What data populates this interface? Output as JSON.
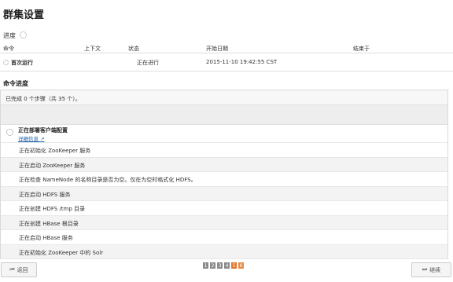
{
  "page": {
    "title": "群集设置",
    "progress_label": "进度"
  },
  "table": {
    "headers": [
      "命令",
      "上下文",
      "状态",
      "开始日期",
      "结束于"
    ],
    "row": {
      "command": "首次运行",
      "context": "",
      "status": "正在进行",
      "start_date": "2015-11-10 19:42:55 CST",
      "end": ""
    }
  },
  "command_progress": {
    "title": "命令进度",
    "summary": "已完成 0 个步骤（共 35 个）。",
    "current_step": {
      "label": "正在部署客户端配置",
      "details_link": "详细信息"
    },
    "steps": [
      "正在初始化 ZooKeeper 服务",
      "正在启动 ZooKeeper 服务",
      "正在检查 NameNode 的名称目录是否为空。仅在为空时格式化 HDFS。",
      "正在启动 HDFS 服务",
      "正在创建 HDFS /tmp 目录",
      "正在创建 HBase 根目录",
      "正在启动 HBase 服务",
      "正在初始化 ZooKeeper 中的 Solr"
    ]
  },
  "footer": {
    "back_label": "返回",
    "next_label": "继续",
    "pages": [
      "1",
      "2",
      "3",
      "4",
      "5",
      "6"
    ],
    "current_page": "5"
  }
}
